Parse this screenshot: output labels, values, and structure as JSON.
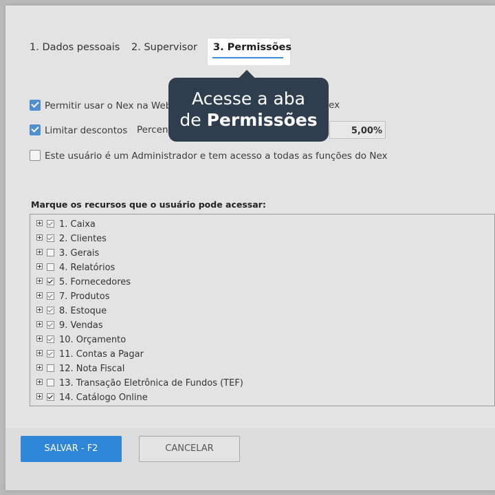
{
  "tabs": {
    "tab1": "1. Dados pessoais",
    "tab2": "2. Supervisor",
    "tab3": "3. Permissões"
  },
  "options": {
    "web": "Permitir usar o Nex na Web",
    "web_tail": "ex",
    "discount": "Limitar descontos",
    "percent_label": "Percent",
    "percent_value": "5,00%",
    "admin": "Este usuário é um Administrador e tem acesso a todas as funções do Nex"
  },
  "tooltip": {
    "line1": "Acesse a aba",
    "line2_prefix": "de ",
    "line2_bold": "Permissões"
  },
  "resources": {
    "label": "Marque os recursos que o usuário pode acessar:",
    "items": [
      {
        "label": "1. Caixa",
        "state": "grey"
      },
      {
        "label": "2. Clientes",
        "state": "grey"
      },
      {
        "label": "3. Gerais",
        "state": "off"
      },
      {
        "label": "4. Relatórios",
        "state": "off"
      },
      {
        "label": "5. Fornecedores",
        "state": "black"
      },
      {
        "label": "7. Produtos",
        "state": "grey"
      },
      {
        "label": "8. Estoque",
        "state": "grey"
      },
      {
        "label": "9. Vendas",
        "state": "grey"
      },
      {
        "label": "10. Orçamento",
        "state": "grey"
      },
      {
        "label": "11. Contas a Pagar",
        "state": "grey"
      },
      {
        "label": "12. Nota Fiscal",
        "state": "off"
      },
      {
        "label": "13. Transação Eletrônica de Fundos (TEF)",
        "state": "off"
      },
      {
        "label": "14. Catálogo Online",
        "state": "black"
      }
    ]
  },
  "buttons": {
    "save": "SALVAR - F2",
    "cancel": "CANCELAR"
  },
  "colors": {
    "accent": "#2f86d8",
    "tooltip_bg": "#2f3e4e"
  }
}
